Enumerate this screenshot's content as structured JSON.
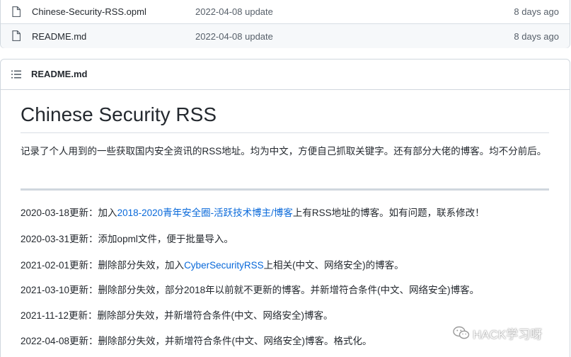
{
  "files": [
    {
      "name": "Chinese-Security-RSS.opml",
      "message": "2022-04-08 update",
      "age": "8 days ago"
    },
    {
      "name": "README.md",
      "message": "2022-04-08 update",
      "age": "8 days ago"
    }
  ],
  "readme": {
    "header_label": "README.md",
    "title": "Chinese Security RSS",
    "intro": "记录了个人用到的一些获取国内安全资讯的RSS地址。均为中文，方便自己抓取关键字。还有部分大佬的博客。均不分前后。",
    "log": [
      {
        "pre": "2020-03-18更新：加入",
        "link": "2018-2020青年安全圈-活跃技术博主/博客",
        "post": "上有RSS地址的博客。如有问题，联系修改！"
      },
      {
        "pre": "2020-03-31更新：添加opml文件，便于批量导入。",
        "link": "",
        "post": ""
      },
      {
        "pre": "2021-02-01更新：删除部分失效，加入",
        "link": "CyberSecurityRSS",
        "post": "上相关(中文、网络安全)的博客。"
      },
      {
        "pre": "2021-03-10更新：删除部分失效，部分2018年以前就不更新的博客。并新增符合条件(中文、网络安全)博客。",
        "link": "",
        "post": ""
      },
      {
        "pre": "2021-11-12更新：删除部分失效，并新增符合条件(中文、网络安全)博客。",
        "link": "",
        "post": ""
      },
      {
        "pre": "2022-04-08更新：删除部分失效，并新增符合条件(中文、网络安全)博客。格式化。",
        "link": "",
        "post": ""
      }
    ]
  },
  "watermark": {
    "text": "HACK学习呀",
    "icon": "wechat-icon"
  },
  "colors": {
    "link": "#0969da",
    "border": "#d0d7de",
    "muted": "#57606a"
  }
}
